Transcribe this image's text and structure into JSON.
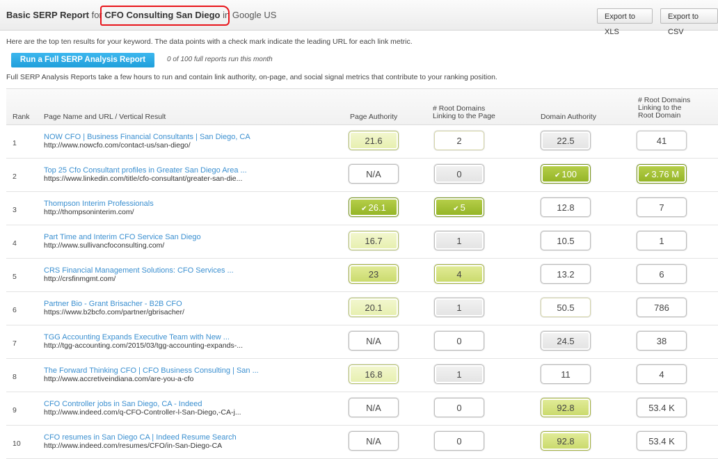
{
  "header": {
    "title_main": "Basic SERP Report",
    "title_for": "for",
    "keyword": "CFO Consulting San Diego",
    "title_engine": "in Google US",
    "export_xls": "Export to XLS",
    "export_csv": "Export to CSV"
  },
  "intro_text": "Here are the top ten results for your keyword. The data points with a check mark indicate the leading URL for each link metric.",
  "run_button": "Run a Full SERP Analysis Report",
  "run_note": "0 of 100 full reports run this month",
  "description": "Full SERP Analysis Reports take a few hours to run and contain link authority, on-page, and social signal metrics that contribute to your ranking position.",
  "columns": {
    "rank": "Rank",
    "page": "Page Name and URL / Vertical Result",
    "pa": "Page Authority",
    "rd_1": "# Root Domains",
    "rd_2": "Linking to the Page",
    "da": "Domain Authority",
    "rdr_1": "# Root Domains",
    "rdr_2": "Linking to the",
    "rdr_3": "Root Domain"
  },
  "rows": [
    {
      "rank": "1",
      "title": "NOW CFO | Business Financial Consultants | San Diego, CA",
      "url": "http://www.nowcfo.com/contact-us/san-diego/",
      "pa": "21.6",
      "rd": "2",
      "da": "22.5",
      "rdr": "41"
    },
    {
      "rank": "2",
      "title": "Top 25 Cfo Consultant profiles in Greater San Diego Area ...",
      "url": "https://www.linkedin.com/title/cfo-consultant/greater-san-die...",
      "pa": "N/A",
      "rd": "0",
      "da": "100",
      "rdr": "3.76 M"
    },
    {
      "rank": "3",
      "title": "Thompson Interim Professionals",
      "url": "http://thompsoninterim.com/",
      "pa": "26.1",
      "rd": "5",
      "da": "12.8",
      "rdr": "7"
    },
    {
      "rank": "4",
      "title": "Part Time and Interim CFO Service San Diego",
      "url": "http://www.sullivancfoconsulting.com/",
      "pa": "16.7",
      "rd": "1",
      "da": "10.5",
      "rdr": "1"
    },
    {
      "rank": "5",
      "title": "CRS Financial Management Solutions: CFO Services ...",
      "url": "http://crsfinmgmt.com/",
      "pa": "23",
      "rd": "4",
      "da": "13.2",
      "rdr": "6"
    },
    {
      "rank": "6",
      "title": "Partner Bio - Grant Brisacher - B2B CFO",
      "url": "https://www.b2bcfo.com/partner/gbrisacher/",
      "pa": "20.1",
      "rd": "1",
      "da": "50.5",
      "rdr": "786"
    },
    {
      "rank": "7",
      "title": "TGG Accounting Expands Executive Team with New ...",
      "url": "http://tgg-accounting.com/2015/03/tgg-accounting-expands-...",
      "pa": "N/A",
      "rd": "0",
      "da": "24.5",
      "rdr": "38"
    },
    {
      "rank": "8",
      "title": "The Forward Thinking CFO | CFO Business Consulting | San ...",
      "url": "http://www.accretiveindiana.com/are-you-a-cfo",
      "pa": "16.8",
      "rd": "1",
      "da": "11",
      "rdr": "4"
    },
    {
      "rank": "9",
      "title": "CFO Controller jobs in San Diego, CA - Indeed",
      "url": "http://www.indeed.com/q-CFO-Controller-l-San-Diego,-CA-j...",
      "pa": "N/A",
      "rd": "0",
      "da": "92.8",
      "rdr": "53.4 K"
    },
    {
      "rank": "10",
      "title": "CFO resumes in San Diego CA | Indeed Resume Search",
      "url": "http://www.indeed.com/resumes/CFO/in-San-Diego-CA",
      "pa": "N/A",
      "rd": "0",
      "da": "92.8",
      "rdr": "53.4 K"
    }
  ],
  "check_icon": "check-circle-icon",
  "colors": {
    "link": "#3a8fd0",
    "button": "#2aa8e4",
    "highlight_oval": "#e8141a",
    "strong": "#a3c235"
  }
}
